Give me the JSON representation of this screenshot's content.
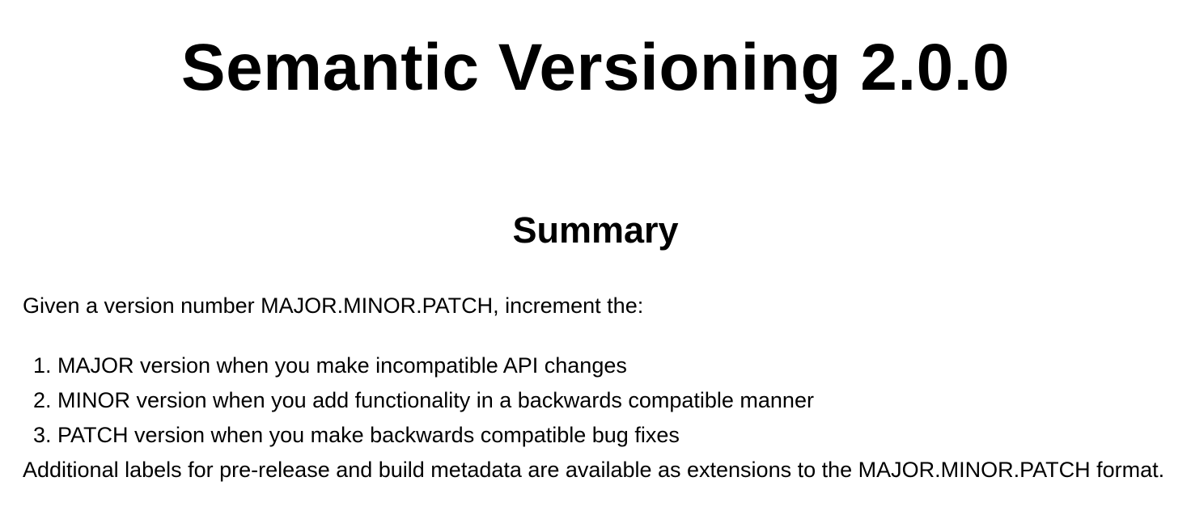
{
  "header": {
    "title": "Semantic Versioning 2.0.0"
  },
  "summary": {
    "heading": "Summary",
    "intro": "Given a version number MAJOR.MINOR.PATCH, increment the:",
    "rules": [
      {
        "number": "1.",
        "text": "MAJOR version when you make incompatible API changes"
      },
      {
        "number": "2.",
        "text": "MINOR version when you add functionality in a backwards compatible manner"
      },
      {
        "number": "3.",
        "text": "PATCH version when you make backwards compatible bug fixes"
      }
    ],
    "outro": "Additional labels for pre-release and build metadata are available as extensions to the MAJOR.MINOR.PATCH format."
  }
}
